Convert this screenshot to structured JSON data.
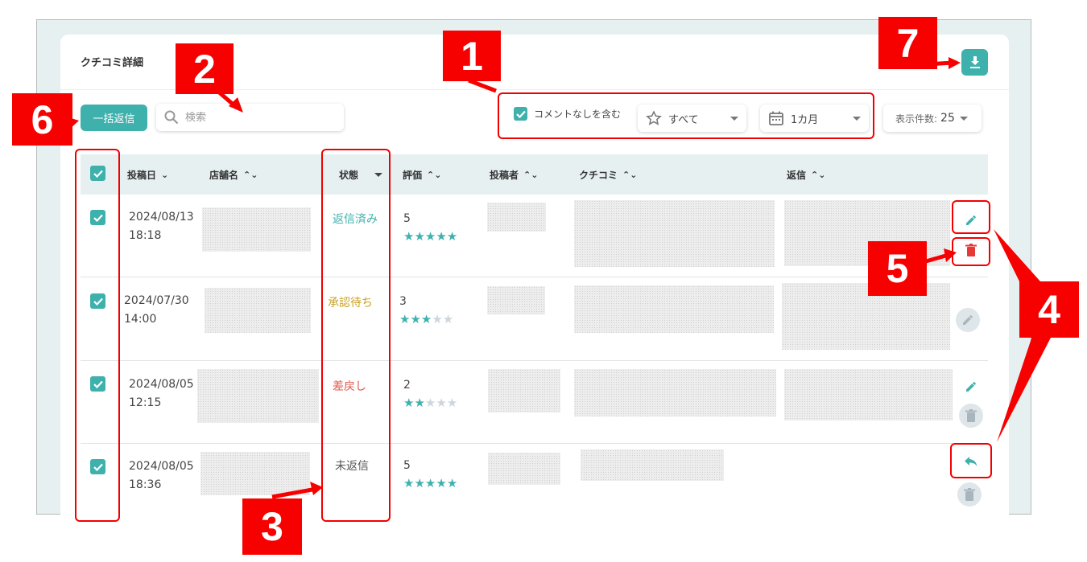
{
  "title": "クチコミ詳細",
  "toolbar": {
    "bulk_reply": "一括返信",
    "search_placeholder": "検索",
    "include_no_comment": "コメントなしを含む",
    "rating_filter": "すべて",
    "period_filter": "1カ月",
    "display_count_label": "表示件数:",
    "display_count_value": "25"
  },
  "columns": {
    "date": "投稿日",
    "store": "店舗名",
    "status": "状態",
    "rating": "評価",
    "author": "投稿者",
    "review": "クチコミ",
    "reply": "返信"
  },
  "rows": [
    {
      "date": "2024/08/13",
      "time": "18:18",
      "status": "返信済み",
      "status_color": "#3fb1ad",
      "rating": "5",
      "stars": 5
    },
    {
      "date": "2024/07/30",
      "time": "14:00",
      "status": "承認待ち",
      "status_color": "#c9a227",
      "rating": "3",
      "stars": 3
    },
    {
      "date": "2024/08/05",
      "time": "12:15",
      "status": "差戻し",
      "status_color": "#e05a4e",
      "rating": "2",
      "stars": 2
    },
    {
      "date": "2024/08/05",
      "time": "18:36",
      "status": "未返信",
      "status_color": "#555555",
      "rating": "5",
      "stars": 5
    }
  ],
  "callouts": {
    "c1": "1",
    "c2": "2",
    "c3": "3",
    "c4": "4",
    "c5": "5",
    "c6": "6",
    "c7": "7"
  },
  "colors": {
    "accent": "#3fb1ad",
    "callout": "#f70000",
    "delete": "#e53935"
  }
}
